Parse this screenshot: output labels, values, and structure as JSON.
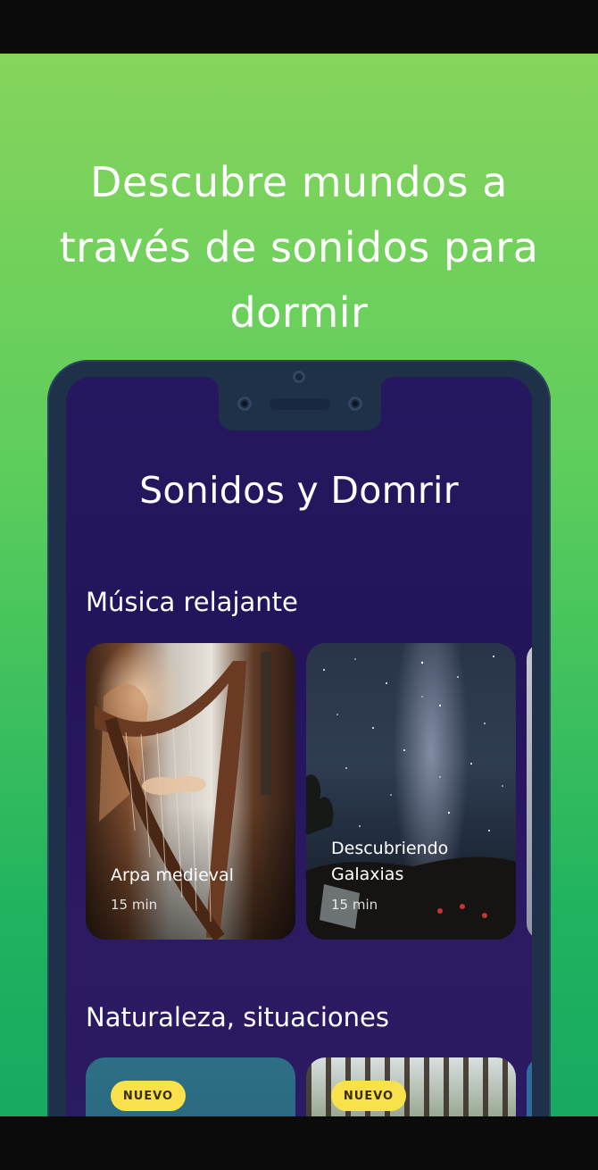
{
  "headline": "Descubre mundos a través de sonidos para dormir",
  "screen": {
    "title": "Sonidos y Domrir",
    "sections": [
      {
        "title": "Música relajante",
        "cards": [
          {
            "title": "Arpa medieval",
            "duration": "15 min"
          },
          {
            "title_line1": "Descubriendo",
            "title_line2": "Galaxias",
            "duration": "15 min"
          }
        ]
      },
      {
        "title": "Naturaleza, situaciones",
        "cards": [
          {
            "badge": "NUEVO"
          },
          {
            "badge": "NUEVO"
          }
        ]
      }
    ]
  },
  "colors": {
    "background_top": "#86d45c",
    "background_bottom": "#17aa60",
    "phone_frame": "#1f3049",
    "screen_background": "#271760",
    "badge": "#f8e14a"
  }
}
